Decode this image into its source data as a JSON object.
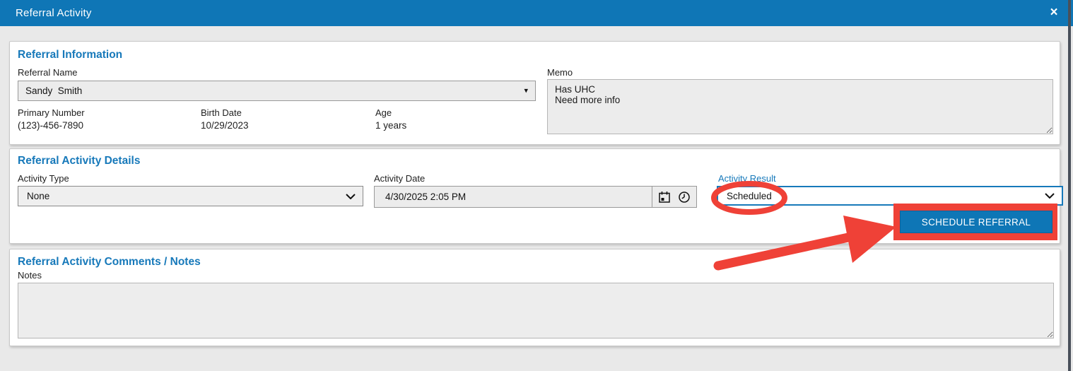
{
  "header": {
    "title": "Referral Activity",
    "close_glyph": "×"
  },
  "referral_information": {
    "heading": "Referral Information",
    "referral_name": {
      "label": "Referral Name",
      "value": "Sandy  Smith"
    },
    "memo": {
      "label": "Memo",
      "value": "Has UHC\nNeed more info"
    },
    "primary_number": {
      "label": "Primary Number",
      "value": "(123)-456-7890"
    },
    "birth_date": {
      "label": "Birth Date",
      "value": "10/29/2023"
    },
    "age": {
      "label": "Age",
      "value": "1 years"
    }
  },
  "referral_activity_details": {
    "heading": "Referral Activity Details",
    "activity_type": {
      "label": "Activity Type",
      "value": "None"
    },
    "activity_date": {
      "label": "Activity Date",
      "value": "4/30/2025 2:05 PM"
    },
    "activity_result": {
      "label": "Activity Result",
      "value": "Scheduled"
    },
    "schedule_button_label": "SCHEDULE REFERRAL"
  },
  "comments": {
    "heading": "Referral Activity Comments / Notes",
    "notes": {
      "label": "Notes",
      "value": ""
    }
  },
  "icons": {
    "dropdown_triangle": "▾"
  },
  "colors": {
    "header_blue": "#0f76b6",
    "heading_blue": "#1779ba",
    "button_blue": "#0e76b6",
    "annotation_red": "#ef4137",
    "field_gray": "#ececec"
  }
}
